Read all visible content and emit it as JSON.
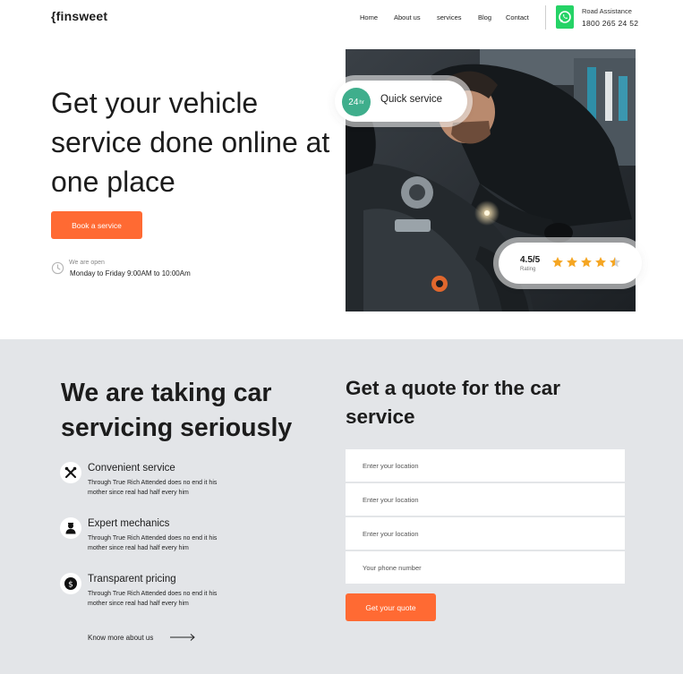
{
  "brand": {
    "logo_text": "{finsweet"
  },
  "nav": {
    "items": [
      {
        "label": "Home"
      },
      {
        "label": "About us"
      },
      {
        "label": "services"
      },
      {
        "label": "Blog"
      },
      {
        "label": "Contact"
      }
    ],
    "road_assistance_label": "Road Assistance",
    "road_assistance_phone": "1800 265 24 52"
  },
  "hero": {
    "title": "Get your vehicle service done online at one place",
    "cta_label": "Book a service",
    "open_label": "We are open",
    "open_hours": "Monday to Friday 9:00AM to 10:00Am",
    "quick_badge_value": "24",
    "quick_badge_unit": "hr",
    "quick_label": "Quick service",
    "rating_value": "4.5/5",
    "rating_label": "Rating",
    "rating_stars": 4.5
  },
  "features_section": {
    "title": "We are taking car servicing seriously",
    "features": [
      {
        "title": "Convenient service",
        "description": "Through True Rich Attended does no end it his mother since real had half every him",
        "icon": "tools-icon"
      },
      {
        "title": "Expert mechanics",
        "description": "Through True Rich Attended does no end it his mother since real had half every him",
        "icon": "mechanic-icon"
      },
      {
        "title": "Transparent pricing",
        "description": "Through True Rich Attended does no end it his mother since real had half every him",
        "icon": "dollar-icon"
      }
    ],
    "know_more_label": "Know more about us"
  },
  "quote_form": {
    "title": "Get a quote for the car service",
    "fields": [
      {
        "placeholder": "Enter your location"
      },
      {
        "placeholder": "Enter your location"
      },
      {
        "placeholder": "Enter your location"
      },
      {
        "placeholder": "Your phone number"
      }
    ],
    "submit_label": "Get your quote"
  },
  "colors": {
    "accent": "#ff6a33",
    "teal_badge": "#3fae8c",
    "star": "#f5a623",
    "whatsapp": "#25d366",
    "section_bg": "#e3e5e8"
  }
}
